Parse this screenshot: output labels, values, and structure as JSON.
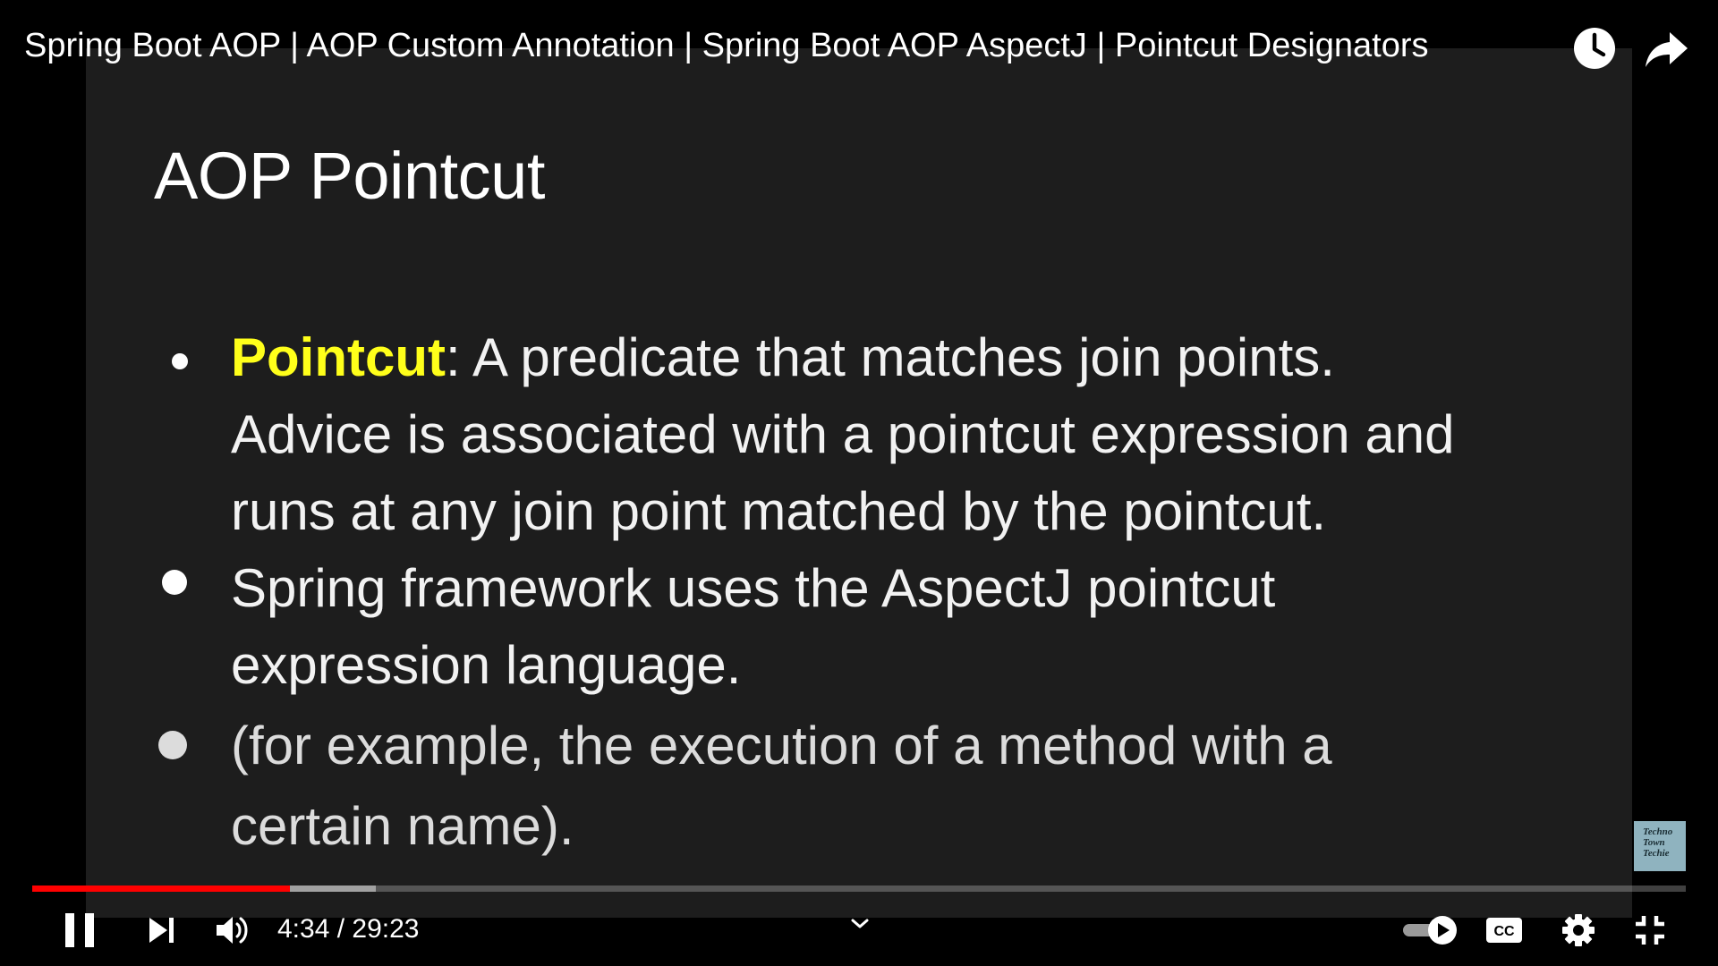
{
  "video": {
    "title": "Spring Boot AOP | AOP Custom Annotation | Spring Boot AOP AspectJ | Pointcut Designators"
  },
  "top_actions": [
    {
      "icon": "clock-icon",
      "action": "watch-later"
    },
    {
      "icon": "share-arrow-icon",
      "action": "share"
    }
  ],
  "slide": {
    "title": "AOP Pointcut",
    "bullets": [
      {
        "highlight": "Pointcut",
        "lines": [
          ": A predicate that matches join points.",
          "Advice is associated with a pointcut expression and",
          "runs at any join point matched by the pointcut."
        ]
      },
      {
        "lines": [
          "Spring framework uses the AspectJ pointcut",
          "expression language."
        ]
      },
      {
        "lines": [
          "(for example, the execution of a method with a",
          "certain name)."
        ]
      }
    ],
    "highlight_color": "#ffff1a"
  },
  "watermark": {
    "lines": [
      "Techno",
      "Town",
      "Techie"
    ]
  },
  "player": {
    "current_time": "4:34",
    "duration": "29:23",
    "time_display": "4:34 / 29:23",
    "played_fraction": 0.156,
    "buffered_fraction": 0.208,
    "progress_color": "#ff0000",
    "controls": [
      {
        "icon": "pause-icon"
      },
      {
        "icon": "next-icon"
      },
      {
        "icon": "volume-icon"
      },
      {
        "icon": "chevron-down-icon"
      },
      {
        "icon": "autoplay-toggle-icon",
        "state": "on"
      },
      {
        "icon": "closed-captions-icon"
      },
      {
        "icon": "settings-gear-icon"
      },
      {
        "icon": "exit-fullscreen-icon"
      }
    ]
  }
}
